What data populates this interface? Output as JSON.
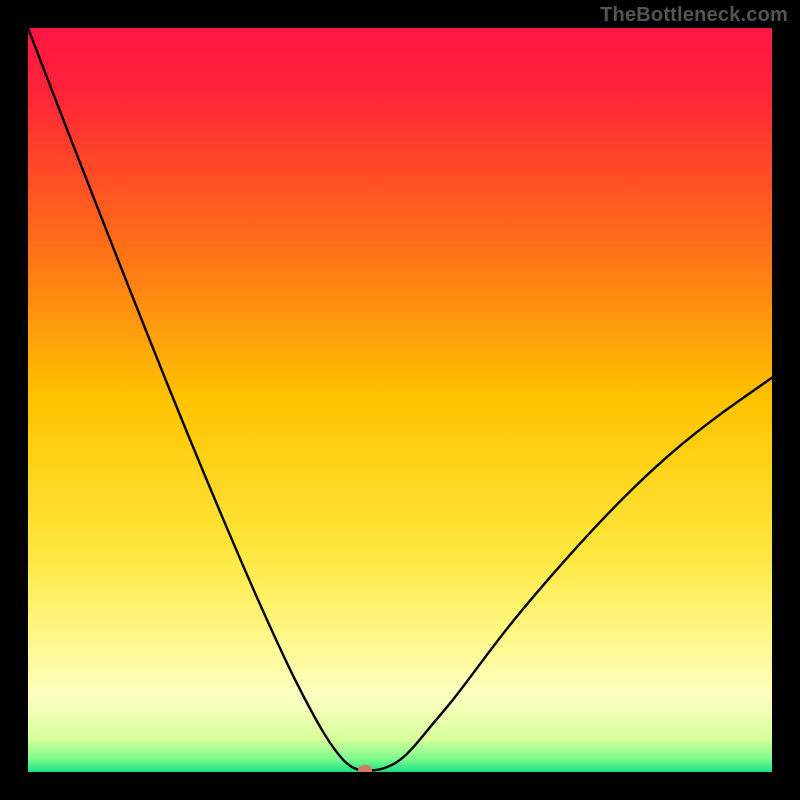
{
  "watermark": "TheBottleneck.com",
  "chart_data": {
    "type": "line",
    "title": "",
    "xlabel": "",
    "ylabel": "",
    "xlim": [
      0,
      100
    ],
    "ylim": [
      0,
      100
    ],
    "grid": false,
    "legend": null,
    "gradient_stops": [
      {
        "offset": 0.0,
        "color": "#ff1744"
      },
      {
        "offset": 0.08,
        "color": "#ff2238"
      },
      {
        "offset": 0.28,
        "color": "#ff6a1a"
      },
      {
        "offset": 0.5,
        "color": "#ffc300"
      },
      {
        "offset": 0.7,
        "color": "#ffe63b"
      },
      {
        "offset": 0.82,
        "color": "#fff88a"
      },
      {
        "offset": 0.9,
        "color": "#fcffc2"
      },
      {
        "offset": 0.955,
        "color": "#d8ff9c"
      },
      {
        "offset": 0.982,
        "color": "#7efc8e"
      },
      {
        "offset": 1.0,
        "color": "#18e084"
      }
    ],
    "series": [
      {
        "name": "curve",
        "x": [
          0.0,
          2.5,
          5.0,
          7.5,
          10.0,
          12.5,
          15.0,
          17.5,
          20.0,
          22.5,
          25.0,
          27.5,
          30.0,
          32.5,
          35.0,
          37.0,
          39.0,
          40.5,
          42.0,
          43.0,
          44.0,
          45.0,
          46.5,
          48.0,
          50.0,
          52.0,
          54.0,
          57.0,
          60.0,
          63.0,
          66.0,
          70.0,
          74.0,
          78.0,
          82.0,
          86.0,
          90.0,
          94.0,
          98.0,
          100.0
        ],
        "y": [
          100.0,
          93.5,
          87.0,
          80.6,
          74.2,
          67.8,
          61.5,
          55.2,
          49.0,
          42.9,
          36.9,
          31.0,
          25.2,
          19.6,
          14.2,
          10.2,
          6.5,
          4.0,
          2.0,
          1.0,
          0.4,
          0.2,
          0.2,
          0.5,
          1.5,
          3.5,
          6.0,
          9.5,
          13.5,
          17.5,
          21.3,
          26.0,
          30.5,
          34.8,
          38.8,
          42.5,
          45.8,
          48.8,
          51.6,
          53.0
        ]
      }
    ],
    "marker": {
      "x": 45.3,
      "y": 0.3,
      "color": "#d47a63",
      "rx": 0.95,
      "ry": 0.65
    },
    "flat_segment": {
      "x0": 42.8,
      "x1": 46.3,
      "y": 0.2
    }
  }
}
